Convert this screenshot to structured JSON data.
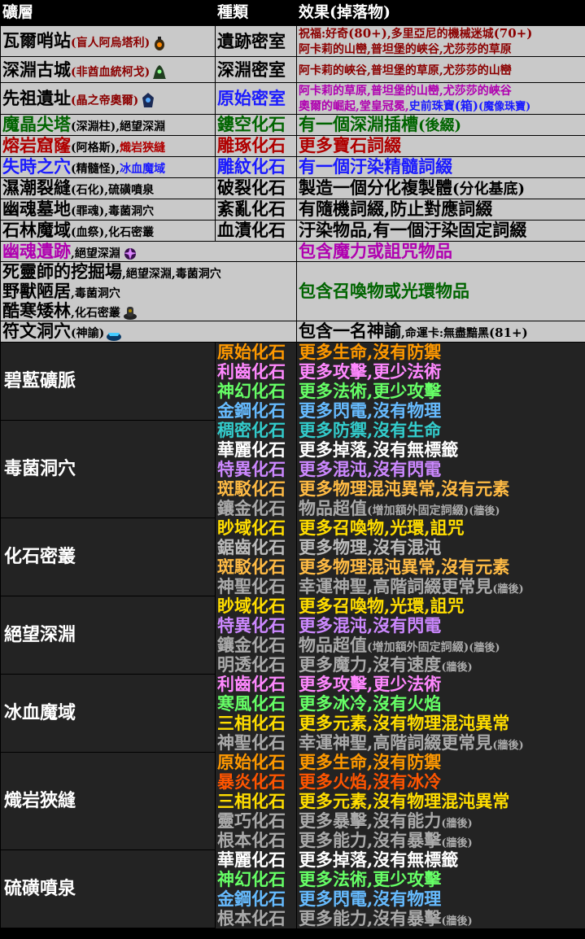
{
  "header": {
    "c1": "礦層",
    "c2": "種類",
    "c3": "效果(掉落物)"
  },
  "light_rows": [
    {
      "type": "single",
      "c1_main": "瓦爾哨站",
      "c1_sub": "(盲人阿烏塔利)",
      "c1_color": "#8b0000",
      "c1_icon": "lantern-icon",
      "c2": "遺跡密室",
      "c2_color": "#000000",
      "c3_lines": [
        [
          {
            "t": "祝福:好奇",
            "c": "#8b0000"
          },
          {
            "t": "(80+)",
            "c": "#8b0000",
            "s": "small"
          },
          {
            "t": ",多里亞尼的機械迷城",
            "c": "#8b0000"
          },
          {
            "t": "(70+)",
            "c": "#8b0000",
            "s": "small"
          }
        ],
        [
          {
            "t": "阿卡莉的山巒,普坦堡的峽谷,尤莎莎的草原",
            "c": "#8b0000"
          }
        ]
      ],
      "c3_size": "sub"
    },
    {
      "type": "single",
      "c1_main": "深淵古城",
      "c1_sub": "(非酋血統柯戈)",
      "c1_color": "#8b0000",
      "c1_icon": "hooded-figure-icon",
      "c2": "深淵密室",
      "c2_color": "#000000",
      "c3_lines": [
        [
          {
            "t": "阿卡莉的峽谷,普坦堡的草原,尤莎莎的山巒",
            "c": "#8b0000"
          }
        ]
      ],
      "c3_size": "sub"
    },
    {
      "type": "single",
      "c1_main": "先祖遺址",
      "c1_sub": "(晶之帝奧爾)",
      "c1_color": "#8b0000",
      "c1_icon": "crystal-king-icon",
      "c2": "原始密室",
      "c2_color": "#1a1aff",
      "c3_lines": [
        [
          {
            "t": "阿卡莉的草原,普坦堡的山巒,尤莎莎的峽谷",
            "c": "#b000b0"
          }
        ],
        [
          {
            "t": "奧爾的崛起,堂皇冠冕,",
            "c": "#b000b0"
          },
          {
            "t": "史前珠寶",
            "c": "#1a1aff"
          },
          {
            "t": "(箱)",
            "c": "#1a1aff",
            "s": "small"
          },
          {
            "t": "(魔像珠寶)",
            "c": "#1a1aff",
            "s": "tiny"
          }
        ]
      ],
      "c3_size": "sub"
    },
    {
      "type": "single",
      "c1_main": "魔晶尖塔",
      "c1_sub": "(深淵柱),絕望深淵",
      "c1_color": "#006400",
      "c1_main_color": "#006400",
      "c1_sub_color": "#000000",
      "c2": "鏤空化石",
      "c2_color": "#006400",
      "c3_lines": [
        [
          {
            "t": "有一個深淵插槽",
            "c": "#006400"
          },
          {
            "t": "(後綴)",
            "c": "#006400",
            "s": "mid2"
          }
        ]
      ],
      "c3_size": "big"
    },
    {
      "type": "single",
      "c1_main": "熔岩窟窿",
      "c1_sub": "(阿格斯),",
      "c1_sub2": "熾岩狹縫",
      "c1_main_color": "#b00000",
      "c1_sub_color": "#000000",
      "c1_sub2_color": "#b00000",
      "c2": "雕琢化石",
      "c2_color": "#b00000",
      "c3_lines": [
        [
          {
            "t": "更多寶石詞綴",
            "c": "#b00000"
          }
        ]
      ],
      "c3_size": "big"
    },
    {
      "type": "single",
      "c1_main": "失時之穴",
      "c1_sub": "(精髓怪),",
      "c1_sub2": "冰血魔域",
      "c1_main_color": "#1a1aff",
      "c1_sub_color": "#000000",
      "c1_sub2_color": "#1a1aff",
      "c2": "雕紋化石",
      "c2_color": "#1a1aff",
      "c3_lines": [
        [
          {
            "t": "有一個汙染精髓詞綴",
            "c": "#1a1aff"
          }
        ]
      ],
      "c3_size": "big"
    },
    {
      "type": "single",
      "c1_main": "濕潮裂縫",
      "c1_sub": "(石化),硫磺噴泉",
      "c1_main_color": "#000000",
      "c1_sub_color": "#000000",
      "c2": "破裂化石",
      "c2_color": "#000000",
      "c3_lines": [
        [
          {
            "t": "製造一個分化複製體",
            "c": "#000000"
          },
          {
            "t": "(分化基底)",
            "c": "#000000",
            "s": "mid2"
          }
        ]
      ],
      "c3_size": "big"
    },
    {
      "type": "single",
      "c1_main": "幽魂墓地",
      "c1_sub": "(罪魂),毒菌洞穴",
      "c1_main_color": "#000000",
      "c1_sub_color": "#000000",
      "c2": "紊亂化石",
      "c2_color": "#000000",
      "c3_lines": [
        [
          {
            "t": "有隨機詞綴,防止對應詞綴",
            "c": "#000000"
          }
        ]
      ],
      "c3_size": "big"
    },
    {
      "type": "single",
      "c1_main": "石林魔域",
      "c1_sub": "(血祭),化石密叢",
      "c1_main_color": "#000000",
      "c1_sub_color": "#000000",
      "c2": "血漬化石",
      "c2_color": "#000000",
      "c3_lines": [
        [
          {
            "t": "汙染物品,有一個汙染固定詞綴",
            "c": "#000000"
          }
        ]
      ],
      "c3_size": "big"
    }
  ],
  "spanned_rows": {
    "wraeth": {
      "c1_main": "幽魂遺跡",
      "c1_sub": ",絕望深淵",
      "c1_main_color": "#b000b0",
      "c1_icon": "purple-orb-icon",
      "c3": "包含魔力或詛咒物品",
      "c3_color": "#b000b0"
    },
    "summon": {
      "lines": [
        {
          "main": "死靈師的挖掘場",
          "sub": ",絕望深淵,毒菌洞穴"
        },
        {
          "main": "野獸陋居",
          "sub": ",毒菌洞穴"
        },
        {
          "main": "酷寒矮林",
          "sub": ",化石密叢",
          "icon": "dark-totem-icon"
        }
      ],
      "c3": "包含召喚物或光環物品",
      "c3_color": "#006400"
    },
    "runes": {
      "c1_main": "符文洞穴",
      "c1_sub": "(神諭)",
      "c1_icon": "blue-rune-icon",
      "c3": "包含一名神諭",
      "c3_sub": ",命運卡:無盡黯黑",
      "c3_sub2": "(81+)"
    }
  },
  "dark_groups": [
    {
      "area": "碧藍礦脈",
      "rows": [
        {
          "fossil": "原始化石",
          "fc": "#ff9900",
          "effect": "更多生命,沒有防禦",
          "ec": "#ff9900"
        },
        {
          "fossil": "利齒化石",
          "fc": "#ff88ff",
          "effect": "更多攻擊,更少法術",
          "ec": "#ff88ff"
        },
        {
          "fossil": "神幻化石",
          "fc": "#66ff66",
          "effect": "更多法術,更少攻擊",
          "ec": "#66ff66"
        },
        {
          "fossil": "金鋼化石",
          "fc": "#66bbff",
          "effect": "更多閃電,沒有物理",
          "ec": "#66bbff"
        }
      ]
    },
    {
      "area": "毒菌洞穴",
      "rows": [
        {
          "fossil": "稠密化石",
          "fc": "#33cccc",
          "effect": "更多防禦,沒有生命",
          "ec": "#33cccc"
        },
        {
          "fossil": "華麗化石",
          "fc": "#ffffff",
          "effect": "更多掉落,沒有無標籤",
          "ec": "#ffffff"
        },
        {
          "fossil": "特異化石",
          "fc": "#cc88ff",
          "effect": "更多混沌,沒有閃電",
          "ec": "#cc88ff"
        },
        {
          "fossil": "斑駁化石",
          "fc": "#ffbb44",
          "effect": "更多物理混沌異常,沒有元素",
          "ec": "#ffbb44"
        },
        {
          "fossil": "鑲金化石",
          "fc": "#aaaaaa",
          "effect": "物品超值",
          "ec": "#aaaaaa",
          "note": "(增加額外固定詞綴)",
          "late": "(牆後)"
        }
      ]
    },
    {
      "area": "化石密叢",
      "rows": [
        {
          "fossil": "眇域化石",
          "fc": "#ffdd00",
          "effect": "更多召喚物,光環,詛咒",
          "ec": "#ffdd00"
        },
        {
          "fossil": "鋸齒化石",
          "fc": "#bbbbbb",
          "effect": "更多物理,沒有混沌",
          "ec": "#bbbbbb"
        },
        {
          "fossil": "斑駁化石",
          "fc": "#ffbb44",
          "effect": "更多物理混沌異常,沒有元素",
          "ec": "#ffbb44"
        },
        {
          "fossil": "神聖化石",
          "fc": "#aaaaaa",
          "effect": "幸運神聖,高階詞綴更常見",
          "ec": "#aaaaaa",
          "late": "(牆後)"
        }
      ]
    },
    {
      "area": "絕望深淵",
      "rows": [
        {
          "fossil": "眇域化石",
          "fc": "#ffdd00",
          "effect": "更多召喚物,光環,詛咒",
          "ec": "#ffdd00"
        },
        {
          "fossil": "特異化石",
          "fc": "#cc88ff",
          "effect": "更多混沌,沒有閃電",
          "ec": "#cc88ff"
        },
        {
          "fossil": "鑲金化石",
          "fc": "#aaaaaa",
          "effect": "物品超值",
          "ec": "#aaaaaa",
          "note": "(增加額外固定詞綴)",
          "late": "(牆後)"
        },
        {
          "fossil": "明透化石",
          "fc": "#aaaaaa",
          "effect": "更多魔力,沒有速度",
          "ec": "#aaaaaa",
          "late": "(牆後)"
        }
      ]
    },
    {
      "area": "冰血魔域",
      "rows": [
        {
          "fossil": "利齒化石",
          "fc": "#ff88ff",
          "effect": "更多攻擊,更少法術",
          "ec": "#ff88ff"
        },
        {
          "fossil": "寒風化石",
          "fc": "#66ff66",
          "effect": "更多冰冷,沒有火焰",
          "ec": "#66ff66"
        },
        {
          "fossil": "三相化石",
          "fc": "#ffdd00",
          "effect": "更多元素,沒有物理混沌異常",
          "ec": "#ffdd00"
        },
        {
          "fossil": "神聖化石",
          "fc": "#aaaaaa",
          "effect": "幸運神聖,高階詞綴更常見",
          "ec": "#aaaaaa",
          "late": "(牆後)"
        }
      ]
    },
    {
      "area": "熾岩狹縫",
      "rows": [
        {
          "fossil": "原始化石",
          "fc": "#ff9900",
          "effect": "更多生命,沒有防禦",
          "ec": "#ff9900"
        },
        {
          "fossil": "暴炎化石",
          "fc": "#ff5500",
          "effect": "更多火焰,沒有冰冷",
          "ec": "#ff5500"
        },
        {
          "fossil": "三相化石",
          "fc": "#ffdd00",
          "effect": "更多元素,沒有物理混沌異常",
          "ec": "#ffdd00"
        },
        {
          "fossil": "靈巧化石",
          "fc": "#aaaaaa",
          "effect": "更多暴擊,沒有能力",
          "ec": "#aaaaaa",
          "late": "(牆後)"
        },
        {
          "fossil": "根本化石",
          "fc": "#aaaaaa",
          "effect": "更多能力,沒有暴擊",
          "ec": "#aaaaaa",
          "late": "(牆後)"
        }
      ]
    },
    {
      "area": "硫磺噴泉",
      "rows": [
        {
          "fossil": "華麗化石",
          "fc": "#ffffff",
          "effect": "更多掉落,沒有無標籤",
          "ec": "#ffffff"
        },
        {
          "fossil": "神幻化石",
          "fc": "#66ff66",
          "effect": "更多法術,更少攻擊",
          "ec": "#66ff66"
        },
        {
          "fossil": "金鋼化石",
          "fc": "#66bbff",
          "effect": "更多閃電,沒有物理",
          "ec": "#66bbff"
        },
        {
          "fossil": "根本化石",
          "fc": "#aaaaaa",
          "effect": "更多能力,沒有暴擊",
          "ec": "#aaaaaa",
          "late": "(牆後)"
        }
      ]
    }
  ]
}
